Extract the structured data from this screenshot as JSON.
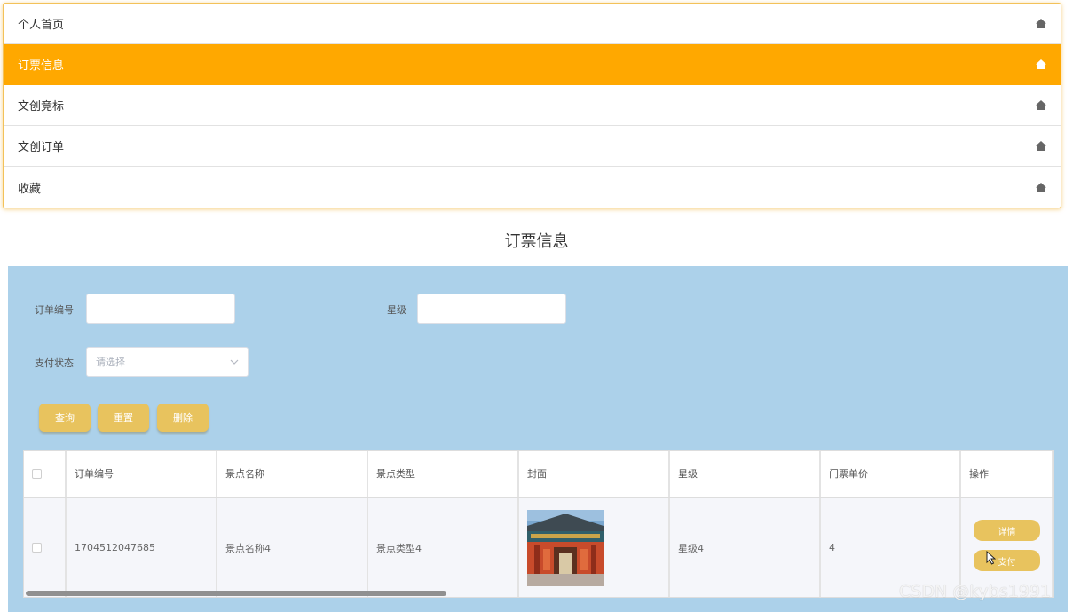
{
  "menu": {
    "items": [
      {
        "label": "个人首页",
        "active": false
      },
      {
        "label": "订票信息",
        "active": true
      },
      {
        "label": "文创竞标",
        "active": false
      },
      {
        "label": "文创订单",
        "active": false
      },
      {
        "label": "收藏",
        "active": false
      }
    ],
    "icon": "home-icon"
  },
  "page_title": "订票信息",
  "search": {
    "order_no_label": "订单编号",
    "order_no_value": "",
    "star_label": "星级",
    "star_value": "",
    "pay_status_label": "支付状态",
    "pay_status_placeholder": "请选择"
  },
  "actions": {
    "query": "查询",
    "reset": "重置",
    "delete": "删除"
  },
  "table": {
    "columns": [
      "订单编号",
      "景点名称",
      "景点类型",
      "封面",
      "星级",
      "门票单价",
      "操作"
    ],
    "rows": [
      {
        "order_no": "1704512047685",
        "scenic_name": "景点名称4",
        "scenic_type": "景点类型4",
        "cover": "temple-gate-image",
        "star": "星级4",
        "price": "4",
        "detail_label": "详情",
        "pay_label": "支付"
      }
    ]
  },
  "colors": {
    "accent": "#ffa800",
    "button": "#e8c35e",
    "panel": "#acd1ea"
  },
  "watermark": "CSDN @kybs1991"
}
